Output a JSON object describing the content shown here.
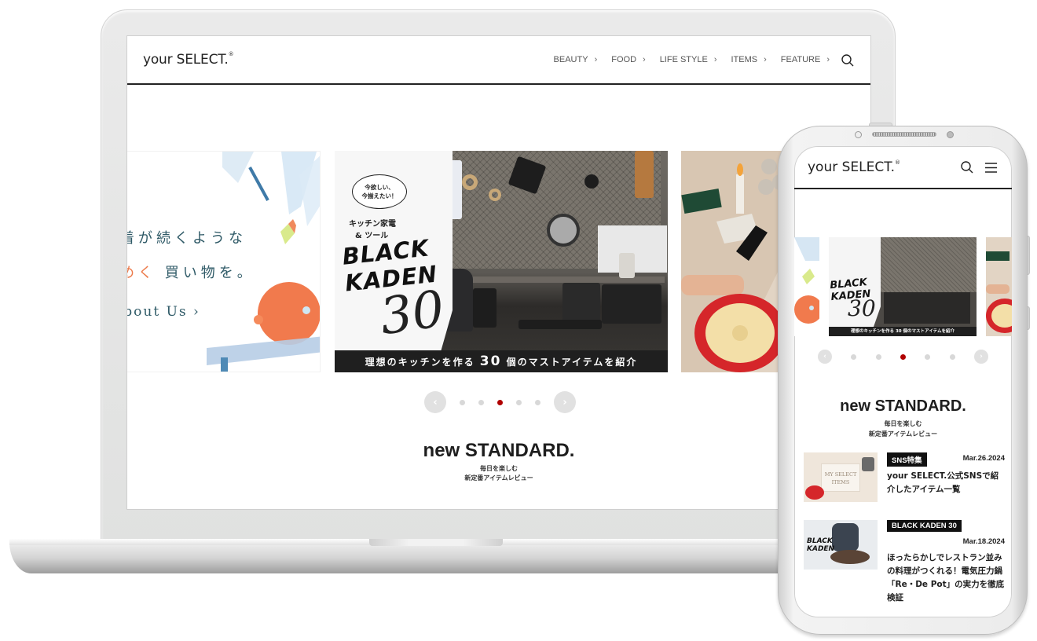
{
  "laptop": {
    "site": {
      "logo": {
        "text": "your SELECT.",
        "mark": "®"
      },
      "nav": [
        {
          "label": "BEAUTY",
          "chevron": "›"
        },
        {
          "label": "FOOD",
          "chevron": "›"
        },
        {
          "label": "LIFE STYLE",
          "chevron": "›"
        },
        {
          "label": "ITEMS",
          "chevron": "›"
        },
        {
          "label": "FEATURE",
          "chevron": "›"
        }
      ],
      "search_icon": "search-icon"
    },
    "carousel": {
      "slides": [
        {
          "id": "about",
          "line1": "着が続くような",
          "line2_accent": "めく",
          "line2_rest": " 買い物を。",
          "link": "About Us ›"
        },
        {
          "id": "black-kaden",
          "bubble": [
            "今欲しい、",
            "今揃えたい！"
          ],
          "subtitle": [
            "キッチン家電",
            "& ツール"
          ],
          "title": [
            "BLACK",
            "KADEN"
          ],
          "number": "30",
          "caption_pre": "理想のキッチンを作る ",
          "caption_num": "30",
          "caption_post": " 個のマストアイテムを紹介"
        },
        {
          "id": "my-select-items"
        }
      ],
      "prev_label": "‹",
      "next_label": "›",
      "dot_count": 5,
      "active_index": 2,
      "accent_color": "#b00000"
    },
    "section": {
      "title": "new STANDARD.",
      "sub1": "毎日を楽しむ",
      "sub2": "新定番アイテムレビュー"
    }
  },
  "phone": {
    "site": {
      "logo": {
        "text": "your SELECT.",
        "mark": "®"
      },
      "search_icon": "search-icon",
      "menu_icon": "hamburger-menu-icon"
    },
    "carousel": {
      "prev_label": "‹",
      "next_label": "›",
      "dot_count": 5,
      "active_index": 2,
      "caption": "理想のキッチンを作る 30 個のマストアイテムを紹介",
      "kaden_title": [
        "BLACK",
        "KADEN"
      ],
      "kaden_num": "30"
    },
    "section": {
      "title": "new STANDARD.",
      "sub1": "毎日を楽しむ",
      "sub2": "新定番アイテムレビュー"
    },
    "articles": [
      {
        "tag": "SNS特集",
        "date": "Mar.26.2024",
        "title": "your SELECT.公式SNSで紹介したアイテム一覧",
        "thumb_text": [
          "MY SELECT",
          "ITEMS"
        ]
      },
      {
        "tag": "BLACK KADEN 30",
        "date": "Mar.18.2024",
        "title": "ほったらかしでレストラン並みの料理がつくれる！電気圧力鍋「Re・De Pot」の実力を徹底検証",
        "thumb_text": [
          "BLACK",
          "KADEN"
        ]
      }
    ]
  }
}
